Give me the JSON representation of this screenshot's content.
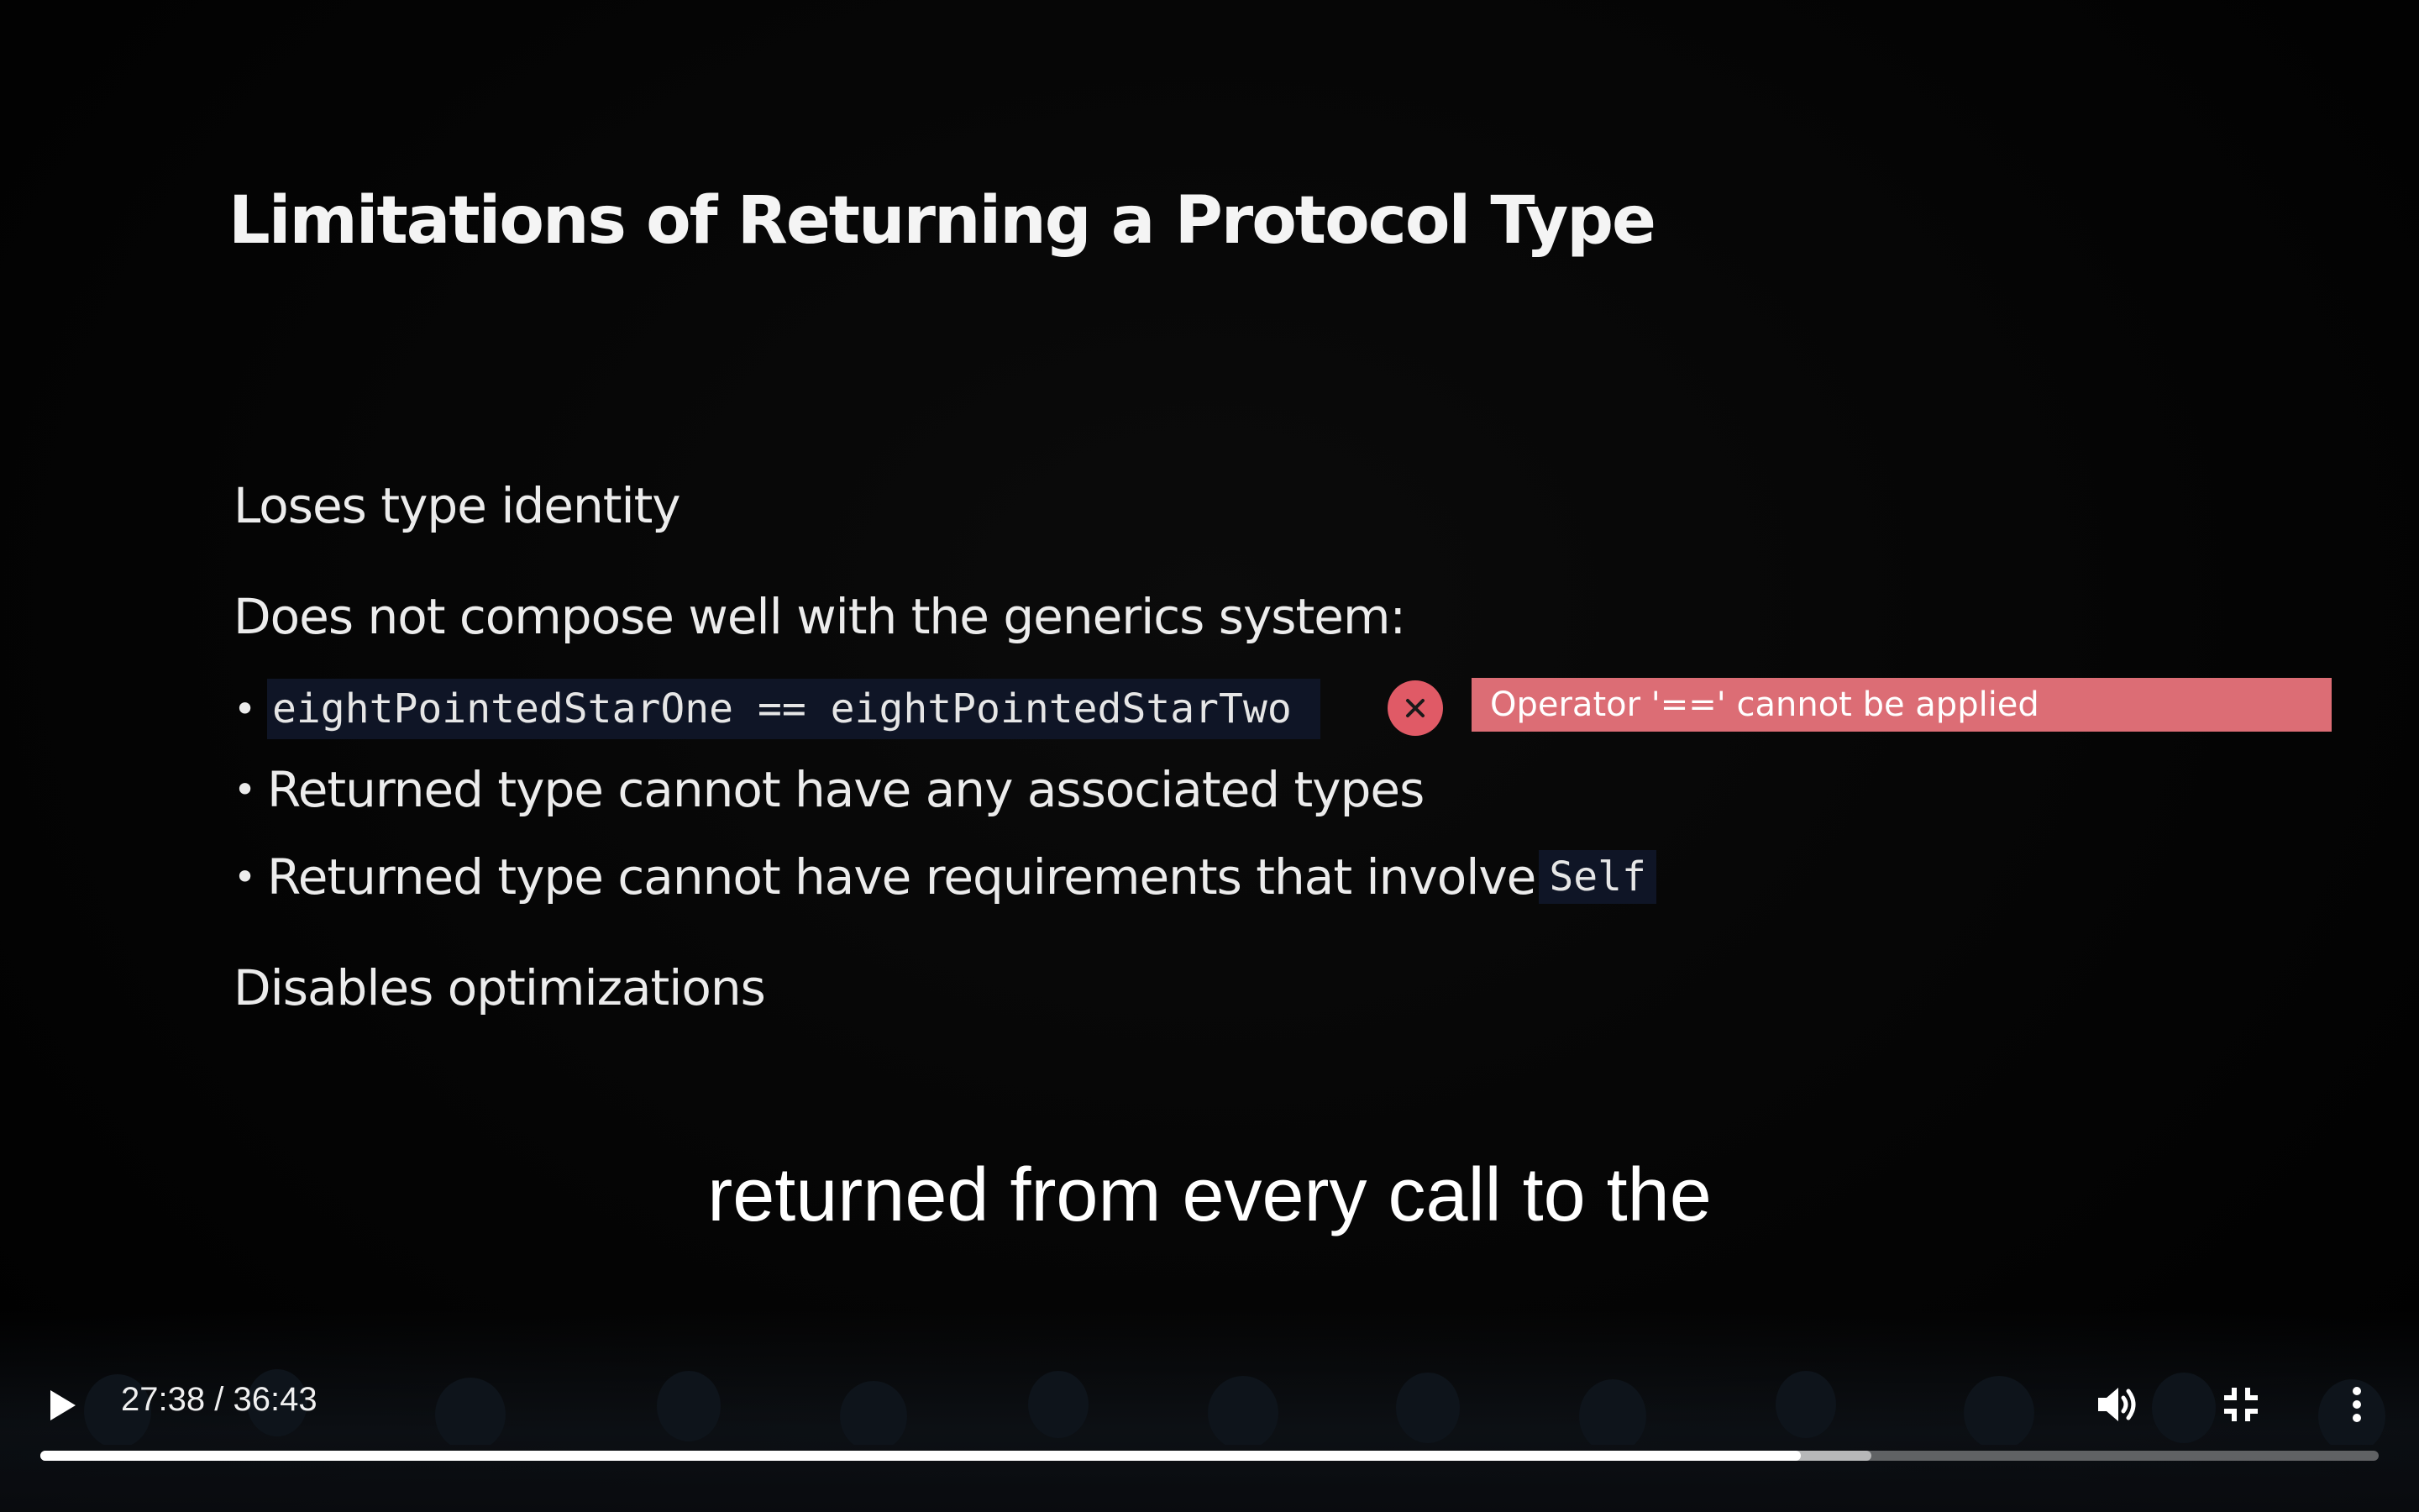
{
  "slide": {
    "title": "Limitations of Returning a Protocol Type",
    "point_1": "Loses type identity",
    "point_2": "Does not compose well with the generics system:",
    "bullet_1_code": "eightPointedStarOne == eightPointedStarTwo",
    "error_message": "Operator '==' cannot be applied",
    "bullet_2": "Returned type cannot have any associated types",
    "bullet_3_text": "Returned type cannot have requirements that involve",
    "bullet_3_code": "Self",
    "point_3": "Disables optimizations",
    "bullet_symbol": "•",
    "error_color": "#e05a66",
    "error_banner_color": "#dc6d75",
    "code_background": "#0f1526"
  },
  "caption": {
    "text": "returned from every call to the"
  },
  "player": {
    "time_current": "27:38",
    "time_separator": "/",
    "time_total": "36:43",
    "progress_played_fraction": 0.753,
    "progress_buffered_fraction": 0.783,
    "icons": {
      "play": "play-icon",
      "volume": "volume-icon",
      "exit_fullscreen": "exit-fullscreen-icon",
      "more": "more-vertical-icon"
    }
  }
}
